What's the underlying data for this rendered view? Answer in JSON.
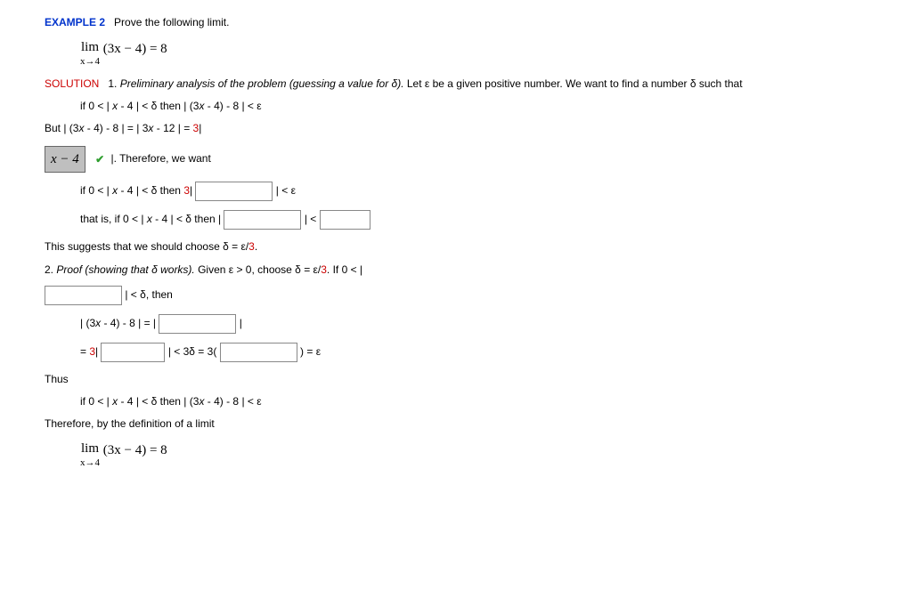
{
  "header": {
    "example_label": "EXAMPLE 2",
    "prompt": "Prove the following limit."
  },
  "limit_expr": {
    "func": "(3x − 4) = 8",
    "approach": "x→4"
  },
  "solution_label": "SOLUTION",
  "step1": {
    "intro_num": "1.",
    "intro_ital": "Preliminary analysis of the problem",
    "intro_paren": "(guessing a value for δ).",
    "intro_rest": " Let ε be a given positive number. We want to find a number δ such that",
    "cond1_a": "if 0 < | ",
    "cond1_x": "x",
    "cond1_b": " - 4 | < δ then | (3",
    "cond1_c": ") - 8 | < ε",
    "but_a": "But | (3",
    "but_x": "x",
    "but_b": " - 4) - 8 | = | 3",
    "but_c": " - 12 | = ",
    "but_3": "3",
    "but_end": "|",
    "answer_value": "x − 4",
    "after_ans": "|. Therefore, we want",
    "cond2_a": "if 0 < | ",
    "cond2_b": " - 4 | < δ then ",
    "cond2_3": "3",
    "cond2_end": "| < ε",
    "cond3_a": "that is, if 0 < | ",
    "cond3_b": " - 4 | < δ then |",
    "cond3_end": "| <",
    "suggest_a": "This suggests that we should choose δ = ε/",
    "suggest_3": "3",
    "suggest_end": "."
  },
  "step2": {
    "intro_num": "2.",
    "intro_ital": "Proof",
    "intro_paren": "(showing that δ works).",
    "intro_rest": " Given ε > 0, choose δ = ε/",
    "intro_3": "3",
    "intro_end": ". If 0 < |",
    "lt_delta": "| < δ, then",
    "eq1_a": "| (3",
    "eq1_x": "x",
    "eq1_b": " - 4) - 8 | = |",
    "eq1_end": "|",
    "eq2_a": "= ",
    "eq2_3a": "3",
    "eq2_b": "| < 3δ = 3(",
    "eq2_end": ") = ε"
  },
  "conclusion": {
    "thus": "Thus",
    "cond_a": "if 0 < | ",
    "cond_x": "x",
    "cond_b": " - 4 | < δ then | (3",
    "cond_c": " - 4) - 8 | < ε",
    "therefore": "Therefore, by the definition of a limit"
  }
}
